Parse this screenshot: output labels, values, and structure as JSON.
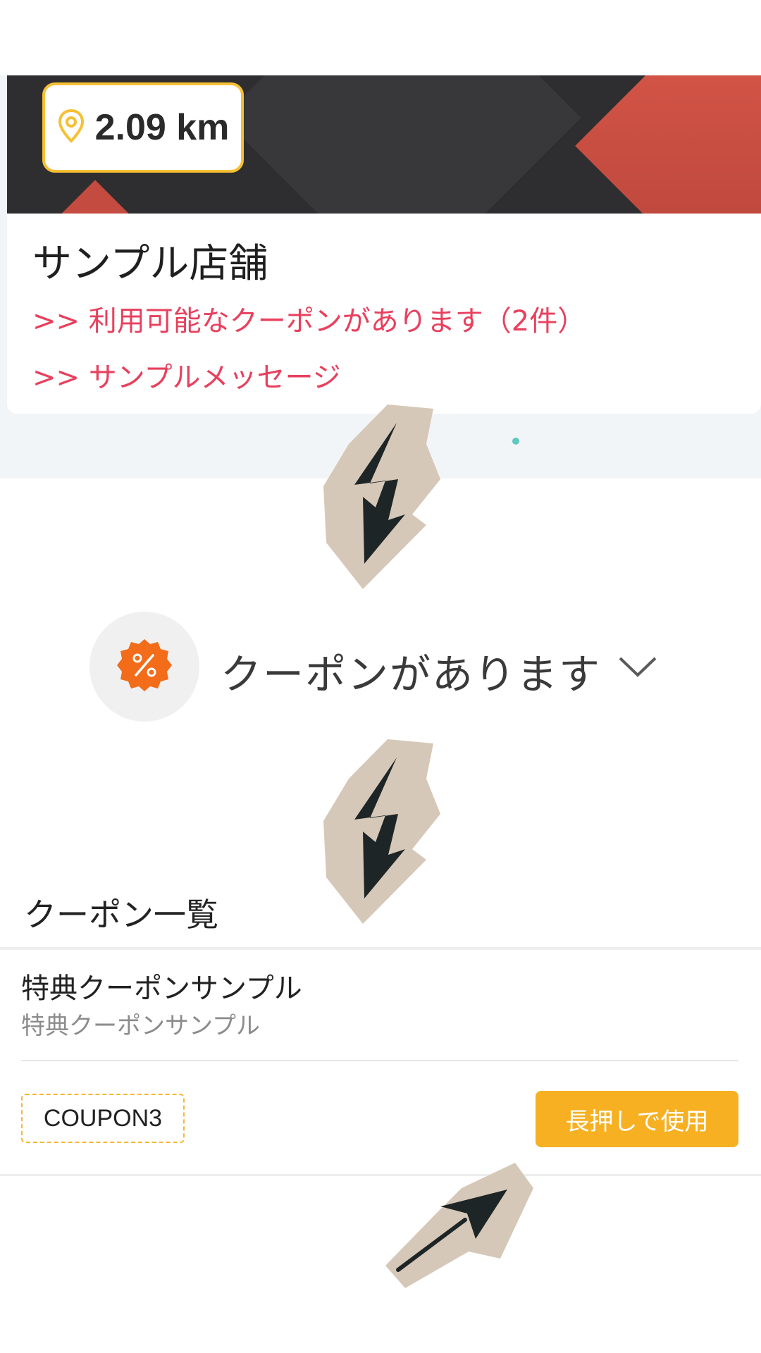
{
  "store_card": {
    "distance": "2.09 km",
    "name": "サンプル店舗",
    "coupon_link": ">> 利用可能なクーポンがあります（2件）",
    "message_link": ">> サンプルメッセージ"
  },
  "coupon_pill": {
    "label": "クーポンがあります",
    "icon": "percent-badge-icon"
  },
  "coupon_list": {
    "title": "クーポン一覧",
    "items": [
      {
        "title": "特典クーポンサンプル",
        "subtitle": "特典クーポンサンプル",
        "code": "COUPON3",
        "action_label": "長押しで使用"
      }
    ]
  },
  "colors": {
    "accent": "#f6b021",
    "link": "#e8405e",
    "badge_border": "#f7c034",
    "coupon_icon": "#f26c1a"
  }
}
